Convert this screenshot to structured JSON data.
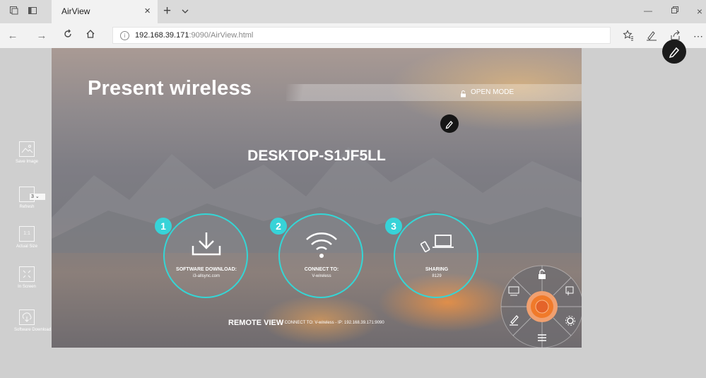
{
  "browser": {
    "tab_title": "AirView",
    "tab_close": "×",
    "new_tab": "+",
    "url_host": "192.168.39.171",
    "url_path": ":9090/AirView.html"
  },
  "sidebar": {
    "items": [
      {
        "label": "Save Image",
        "icon": "image-icon"
      },
      {
        "label": "Refresh",
        "icon": "refresh-icon",
        "badge": "3"
      },
      {
        "label": "Actual Size",
        "icon": "actual-size-icon",
        "box_text": "1:1"
      },
      {
        "label": "In Screen",
        "icon": "in-screen-icon"
      },
      {
        "label": "Software Download",
        "icon": "download-icon"
      }
    ]
  },
  "main": {
    "title": "Present wireless",
    "open_mode": "OPEN MODE",
    "device_name": "DESKTOP-S1JF5LL",
    "steps": [
      {
        "number": "1",
        "label": "SOFTWARE DOWNLOAD:",
        "value": "i3-allsync.com",
        "icon": "download-icon"
      },
      {
        "number": "2",
        "label": "CONNECT TO:",
        "value": "V-wireless",
        "icon": "wifi-icon"
      },
      {
        "number": "3",
        "label": "SHARING",
        "value": "8129",
        "icon": "sharing-icon"
      }
    ],
    "remote_view": "REMOTE VIEW",
    "remote_detail": "- CONNECT TO: V-wireless - IP: 192.168.39.171:9090"
  },
  "colors": {
    "accent": "#34d6d6",
    "radial_center": "#f07a2a"
  }
}
